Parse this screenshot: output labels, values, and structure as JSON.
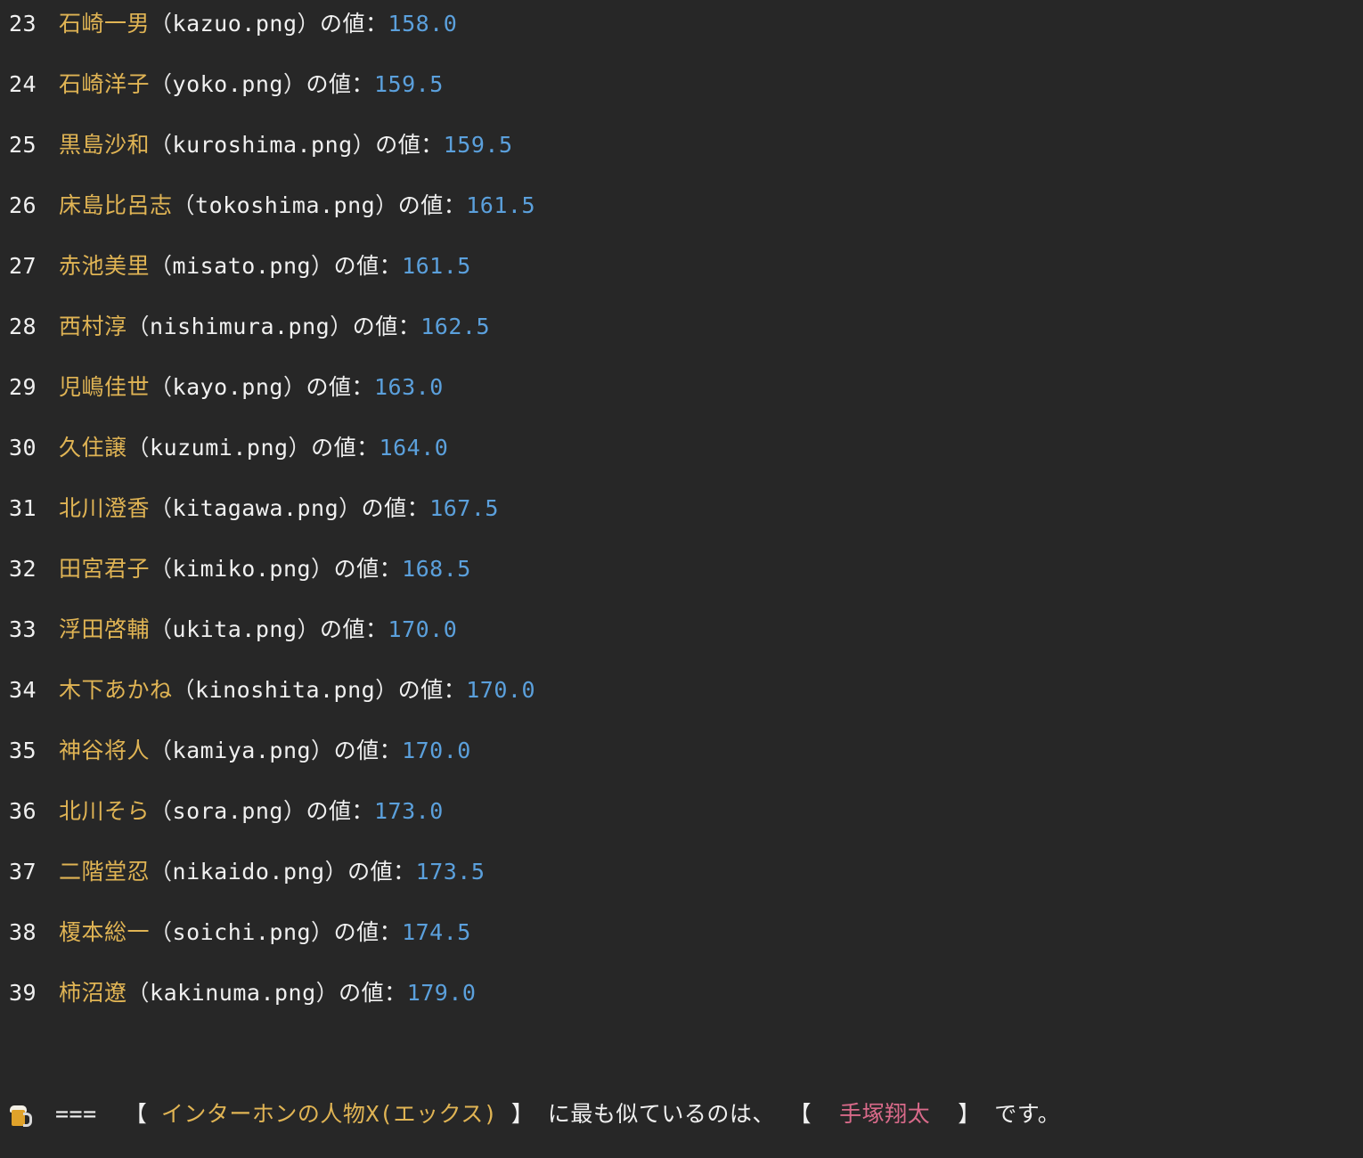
{
  "rows": [
    {
      "num": "23",
      "name": "石崎一男",
      "file": "kazuo.png",
      "value": "158.0"
    },
    {
      "num": "24",
      "name": "石崎洋子",
      "file": "yoko.png",
      "value": "159.5"
    },
    {
      "num": "25",
      "name": "黒島沙和",
      "file": "kuroshima.png",
      "value": "159.5"
    },
    {
      "num": "26",
      "name": "床島比呂志",
      "file": "tokoshima.png",
      "value": "161.5"
    },
    {
      "num": "27",
      "name": "赤池美里",
      "file": "misato.png",
      "value": "161.5"
    },
    {
      "num": "28",
      "name": "西村淳",
      "file": "nishimura.png",
      "value": "162.5"
    },
    {
      "num": "29",
      "name": "児嶋佳世",
      "file": "kayo.png",
      "value": "163.0"
    },
    {
      "num": "30",
      "name": "久住譲",
      "file": "kuzumi.png",
      "value": "164.0"
    },
    {
      "num": "31",
      "name": "北川澄香",
      "file": "kitagawa.png",
      "value": "167.5"
    },
    {
      "num": "32",
      "name": "田宮君子",
      "file": "kimiko.png",
      "value": "168.5"
    },
    {
      "num": "33",
      "name": "浮田啓輔",
      "file": "ukita.png",
      "value": "170.0"
    },
    {
      "num": "34",
      "name": "木下あかね",
      "file": "kinoshita.png",
      "value": "170.0"
    },
    {
      "num": "35",
      "name": "神谷将人",
      "file": "kamiya.png",
      "value": "170.0"
    },
    {
      "num": "36",
      "name": "北川そら",
      "file": "sora.png",
      "value": "173.0"
    },
    {
      "num": "37",
      "name": "二階堂忍",
      "file": "nikaido.png",
      "value": "173.5"
    },
    {
      "num": "38",
      "name": "榎本総一",
      "file": "soichi.png",
      "value": "174.5"
    },
    {
      "num": "39",
      "name": "柿沼遼",
      "file": "kakinuma.png",
      "value": "179.0"
    }
  ],
  "row_labels": {
    "open_paren": "（",
    "close_paren": "）",
    "suffix": "の値：",
    "separator": " "
  },
  "result": {
    "icon": "beer-mug-icon",
    "prefix": "===",
    "open_bracket": "【",
    "subject": "インターホンの人物X(エックス)",
    "close_bracket": "】",
    "middle": "に最も似ているのは、",
    "answer": "手塚翔太",
    "end": "です。"
  },
  "colors": {
    "background": "#272727",
    "name": "#e0b454",
    "value": "#5ba0dc",
    "answer": "#d96a8a",
    "text": "#f0f0f0"
  }
}
